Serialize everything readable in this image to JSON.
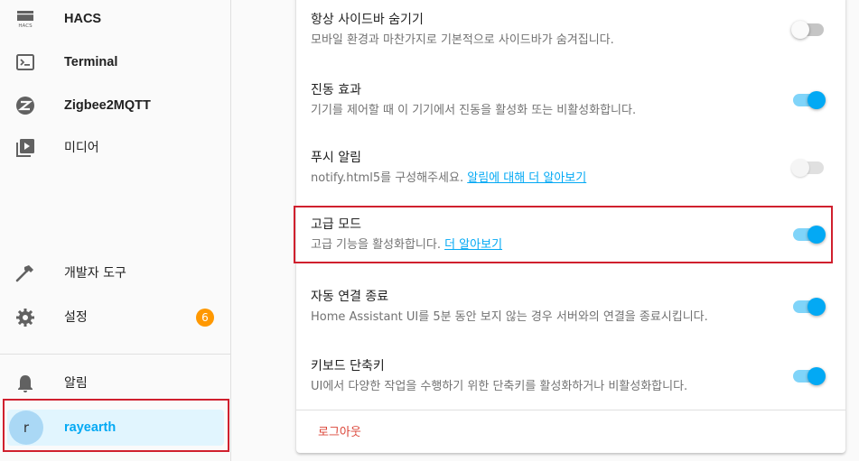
{
  "sidebar": {
    "items": [
      {
        "label": "HACS",
        "icon": "hacs-icon",
        "icon_text": "HACS"
      },
      {
        "label": "Terminal",
        "icon": "terminal-icon"
      },
      {
        "label": "Zigbee2MQTT",
        "icon": "zigbee-icon"
      },
      {
        "label": "미디어",
        "icon": "media-icon"
      },
      {
        "label": "개발자 도구",
        "icon": "hammer-icon"
      },
      {
        "label": "설정",
        "icon": "gear-icon",
        "badge": "6"
      },
      {
        "label": "알림",
        "icon": "bell-icon"
      }
    ],
    "user": {
      "initial": "r",
      "name": "rayearth"
    }
  },
  "settings": {
    "rows": [
      {
        "title": "항상 사이드바 숨기기",
        "description": "모바일 환경과 마찬가지로 기본적으로 사이드바가 숨겨집니다.",
        "toggle": "off"
      },
      {
        "title": "진동 효과",
        "description": "기기를 제어할 때 이 기기에서 진동을 활성화 또는 비활성화합니다.",
        "toggle": "on"
      },
      {
        "title": "푸시 알림",
        "description": "notify.html5를 구성해주세요. ",
        "link": "알림에 대해 더 알아보기",
        "toggle": "disabled"
      },
      {
        "title": "고급 모드",
        "description": "고급 기능을 활성화합니다. ",
        "link": "더 알아보기",
        "toggle": "on"
      },
      {
        "title": "자동 연결 종료",
        "description": "Home Assistant UI를 5분 동안 보지 않는 경우 서버와의 연결을 종료시킵니다.",
        "toggle": "on"
      },
      {
        "title": "키보드 단축키",
        "description": "UI에서 다양한 작업을 수행하기 위한 단축키를 활성화하거나 비활성화합니다.",
        "toggle": "on"
      }
    ],
    "logout_label": "로그아웃"
  },
  "colors": {
    "accent": "#03a9f4",
    "badge": "#ff9800",
    "logout": "#db4437",
    "highlight": "#d0202e"
  }
}
